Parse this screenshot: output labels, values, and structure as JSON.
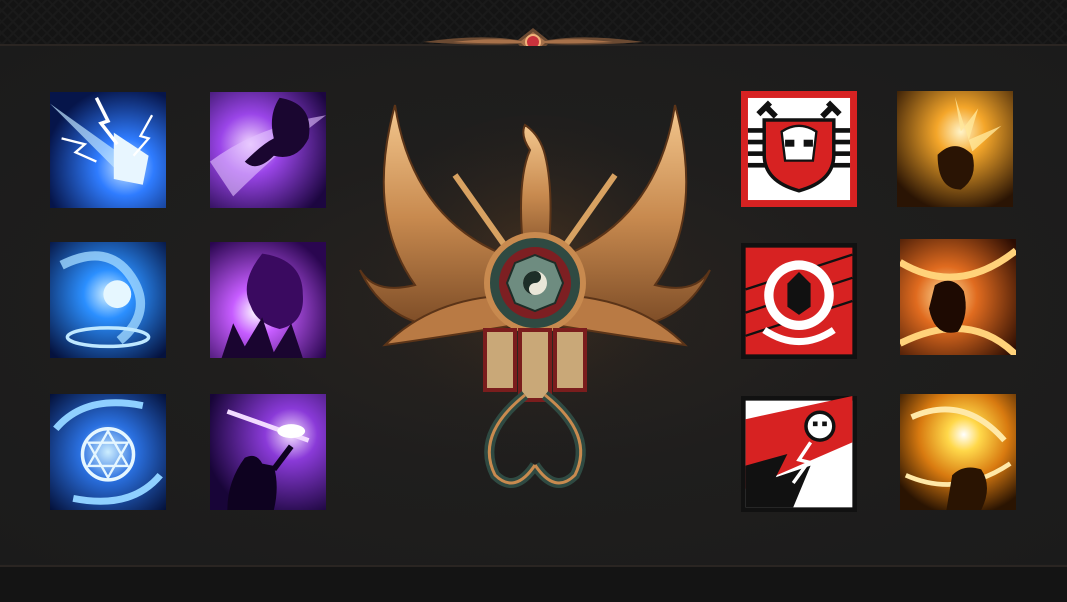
{
  "screen": "skill-icons-showcase",
  "header": {
    "ornament_icon": "dragon-gem-ornament-icon"
  },
  "emblem": {
    "icon": "golden-phoenix-taiji-emblem-icon"
  },
  "left_columns": [
    {
      "theme": "blue",
      "accent": "#3fa6ff",
      "icons": [
        "lightning-dash-icon",
        "water-whirl-icon",
        "arcane-sigil-icon"
      ]
    },
    {
      "theme": "purple",
      "accent": "#a64dff",
      "icons": [
        "shadow-spirit-icon",
        "dark-flame-icon",
        "warrior-strike-icon"
      ]
    }
  ],
  "right_columns": [
    {
      "theme": "red",
      "accent": "#d72222",
      "icons": [
        "skull-shield-icon",
        "crescent-mask-icon",
        "skull-lightning-icon"
      ]
    },
    {
      "theme": "gold",
      "accent": "#f4a62a",
      "icons": [
        "sun-warrior-icon",
        "fire-slash-icon",
        "radiant-burst-icon"
      ]
    }
  ]
}
